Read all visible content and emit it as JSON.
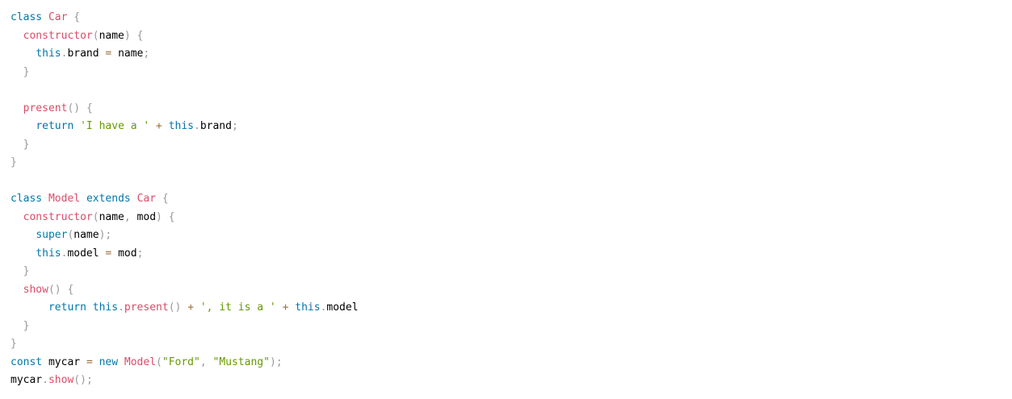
{
  "language": "javascript",
  "colors": {
    "keyword": "#0077aa",
    "function": "#dd4a68",
    "string": "#669900",
    "punctuation": "#999999",
    "operator": "#9a6e3a",
    "text": "#000000",
    "background": "#ffffff"
  },
  "lines": [
    [
      [
        "kw",
        "class"
      ],
      [
        "id",
        " "
      ],
      [
        "fn",
        "Car"
      ],
      [
        "id",
        " "
      ],
      [
        "p",
        "{"
      ]
    ],
    [
      [
        "id",
        "  "
      ],
      [
        "fn",
        "constructor"
      ],
      [
        "p",
        "("
      ],
      [
        "id",
        "name"
      ],
      [
        "p",
        ")"
      ],
      [
        "id",
        " "
      ],
      [
        "p",
        "{"
      ]
    ],
    [
      [
        "id",
        "    "
      ],
      [
        "kw",
        "this"
      ],
      [
        "p",
        "."
      ],
      [
        "id",
        "brand "
      ],
      [
        "op",
        "="
      ],
      [
        "id",
        " name"
      ],
      [
        "p",
        ";"
      ]
    ],
    [
      [
        "id",
        "  "
      ],
      [
        "p",
        "}"
      ]
    ],
    [],
    [
      [
        "id",
        "  "
      ],
      [
        "fn",
        "present"
      ],
      [
        "p",
        "()"
      ],
      [
        "id",
        " "
      ],
      [
        "p",
        "{"
      ]
    ],
    [
      [
        "id",
        "    "
      ],
      [
        "kw",
        "return"
      ],
      [
        "id",
        " "
      ],
      [
        "str",
        "'I have a '"
      ],
      [
        "id",
        " "
      ],
      [
        "op",
        "+"
      ],
      [
        "id",
        " "
      ],
      [
        "kw",
        "this"
      ],
      [
        "p",
        "."
      ],
      [
        "id",
        "brand"
      ],
      [
        "p",
        ";"
      ]
    ],
    [
      [
        "id",
        "  "
      ],
      [
        "p",
        "}"
      ]
    ],
    [
      [
        "p",
        "}"
      ]
    ],
    [],
    [
      [
        "kw",
        "class"
      ],
      [
        "id",
        " "
      ],
      [
        "fn",
        "Model"
      ],
      [
        "id",
        " "
      ],
      [
        "kw",
        "extends"
      ],
      [
        "id",
        " "
      ],
      [
        "fn",
        "Car"
      ],
      [
        "id",
        " "
      ],
      [
        "p",
        "{"
      ]
    ],
    [
      [
        "id",
        "  "
      ],
      [
        "fn",
        "constructor"
      ],
      [
        "p",
        "("
      ],
      [
        "id",
        "name"
      ],
      [
        "p",
        ","
      ],
      [
        "id",
        " mod"
      ],
      [
        "p",
        ")"
      ],
      [
        "id",
        " "
      ],
      [
        "p",
        "{"
      ]
    ],
    [
      [
        "id",
        "    "
      ],
      [
        "kw",
        "super"
      ],
      [
        "p",
        "("
      ],
      [
        "id",
        "name"
      ],
      [
        "p",
        ")"
      ],
      [
        "p",
        ";"
      ]
    ],
    [
      [
        "id",
        "    "
      ],
      [
        "kw",
        "this"
      ],
      [
        "p",
        "."
      ],
      [
        "id",
        "model "
      ],
      [
        "op",
        "="
      ],
      [
        "id",
        " mod"
      ],
      [
        "p",
        ";"
      ]
    ],
    [
      [
        "id",
        "  "
      ],
      [
        "p",
        "}"
      ]
    ],
    [
      [
        "id",
        "  "
      ],
      [
        "fn",
        "show"
      ],
      [
        "p",
        "()"
      ],
      [
        "id",
        " "
      ],
      [
        "p",
        "{"
      ]
    ],
    [
      [
        "id",
        "      "
      ],
      [
        "kw",
        "return"
      ],
      [
        "id",
        " "
      ],
      [
        "kw",
        "this"
      ],
      [
        "p",
        "."
      ],
      [
        "fn",
        "present"
      ],
      [
        "p",
        "()"
      ],
      [
        "id",
        " "
      ],
      [
        "op",
        "+"
      ],
      [
        "id",
        " "
      ],
      [
        "str",
        "', it is a '"
      ],
      [
        "id",
        " "
      ],
      [
        "op",
        "+"
      ],
      [
        "id",
        " "
      ],
      [
        "kw",
        "this"
      ],
      [
        "p",
        "."
      ],
      [
        "id",
        "model"
      ]
    ],
    [
      [
        "id",
        "  "
      ],
      [
        "p",
        "}"
      ]
    ],
    [
      [
        "p",
        "}"
      ]
    ],
    [
      [
        "kw",
        "const"
      ],
      [
        "id",
        " mycar "
      ],
      [
        "op",
        "="
      ],
      [
        "id",
        " "
      ],
      [
        "kw",
        "new"
      ],
      [
        "id",
        " "
      ],
      [
        "fn",
        "Model"
      ],
      [
        "p",
        "("
      ],
      [
        "str",
        "\"Ford\""
      ],
      [
        "p",
        ","
      ],
      [
        "id",
        " "
      ],
      [
        "str",
        "\"Mustang\""
      ],
      [
        "p",
        ")"
      ],
      [
        "p",
        ";"
      ]
    ],
    [
      [
        "id",
        "mycar"
      ],
      [
        "p",
        "."
      ],
      [
        "fn",
        "show"
      ],
      [
        "p",
        "()"
      ],
      [
        "p",
        ";"
      ]
    ]
  ]
}
